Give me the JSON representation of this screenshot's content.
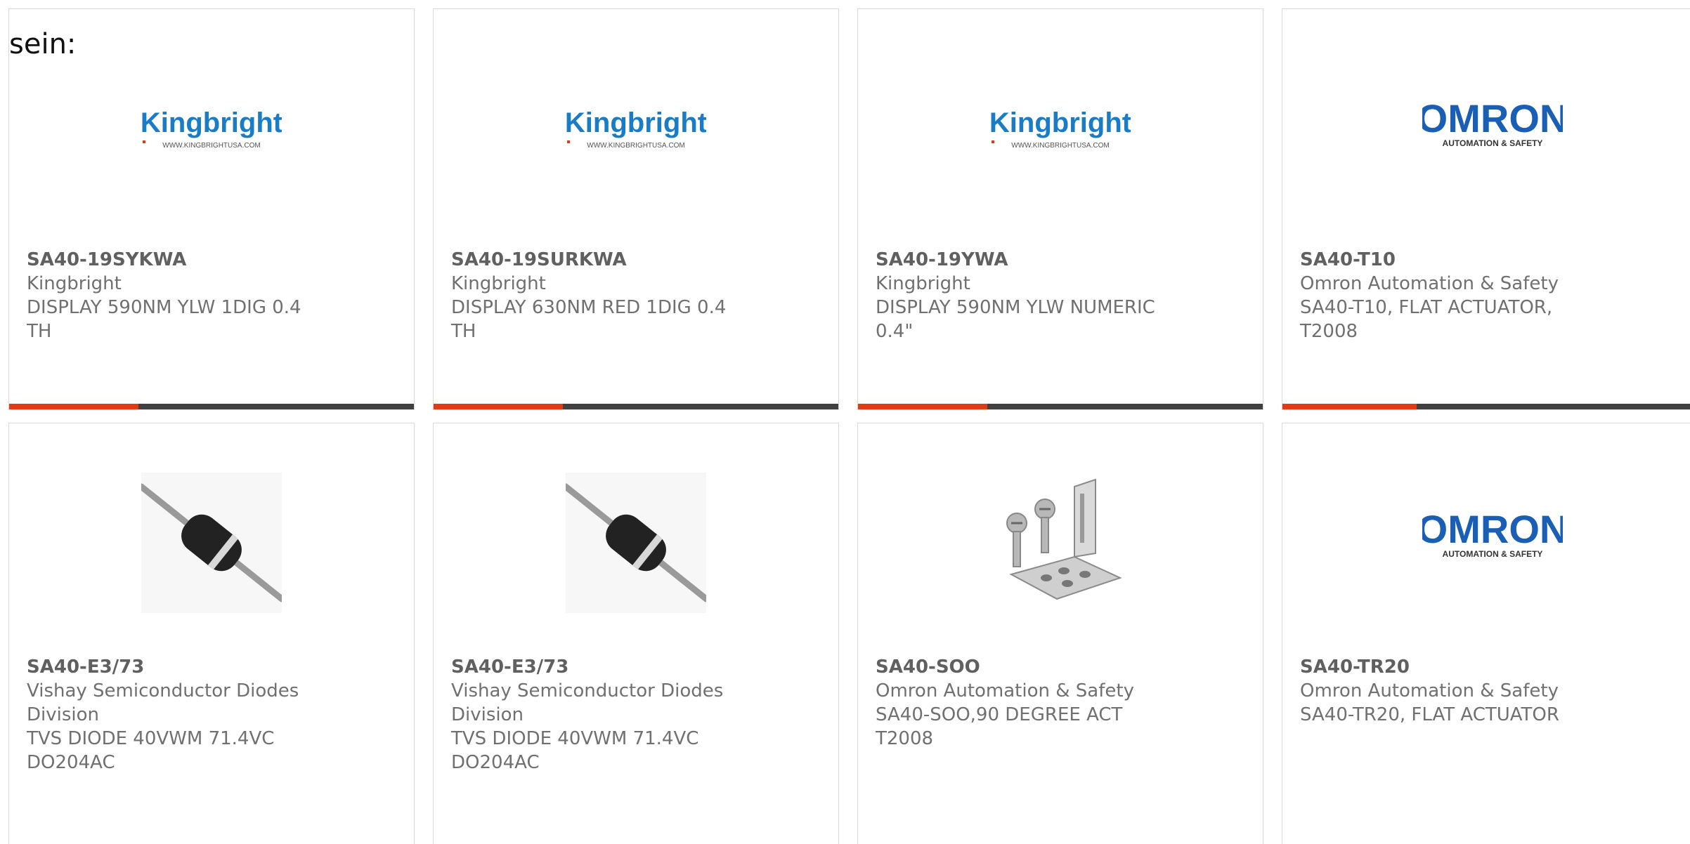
{
  "header": {
    "text": "sein:"
  },
  "products": [
    {
      "part_number": "SA40-19SYKWA",
      "manufacturer": "Kingbright",
      "desc_line1": "DISPLAY 590NM YLW 1DIG 0.4",
      "desc_line2": "TH",
      "image": "kingbright-logo",
      "logo_text": "Kingbright",
      "logo_url": "WWW.KINGBRIGHTUSA.COM"
    },
    {
      "part_number": "SA40-19SURKWA",
      "manufacturer": "Kingbright",
      "desc_line1": "DISPLAY 630NM RED 1DIG 0.4",
      "desc_line2": "TH",
      "image": "kingbright-logo",
      "logo_text": "Kingbright",
      "logo_url": "WWW.KINGBRIGHTUSA.COM"
    },
    {
      "part_number": "SA40-19YWA",
      "manufacturer": "Kingbright",
      "desc_line1": "DISPLAY 590NM YLW NUMERIC",
      "desc_line2": "0.4\"",
      "image": "kingbright-logo",
      "logo_text": "Kingbright",
      "logo_url": "WWW.KINGBRIGHTUSA.COM"
    },
    {
      "part_number": "SA40-T10",
      "manufacturer": "Omron Automation & Safety",
      "desc_line1": "SA40-T10, FLAT ACTUATOR,",
      "desc_line2": "T2008",
      "image": "omron-logo",
      "logo_text": "OMRON",
      "logo_sub": "AUTOMATION & SAFETY"
    },
    {
      "part_number": "SA40-E3/73",
      "manufacturer_line1": "Vishay Semiconductor Diodes",
      "manufacturer_line2": "Division",
      "desc_line1": "TVS DIODE 40VWM 71.4VC",
      "desc_line2": "DO204AC",
      "image": "diode-photo"
    },
    {
      "part_number": "SA40-E3/73",
      "manufacturer_line1": "Vishay Semiconductor Diodes",
      "manufacturer_line2": "Division",
      "desc_line1": "TVS DIODE 40VWM 71.4VC",
      "desc_line2": "DO204AC",
      "image": "diode-photo"
    },
    {
      "part_number": "SA40-SOO",
      "manufacturer": "Omron Automation & Safety",
      "desc_line1": "SA40-SOO,90 DEGREE ACT T2008",
      "image": "bracket-photo"
    },
    {
      "part_number": "SA40-TR20",
      "manufacturer": "Omron Automation & Safety",
      "desc_line1": "SA40-TR20, FLAT ACTUATOR",
      "image": "omron-logo",
      "logo_text": "OMRON",
      "logo_sub": "AUTOMATION & SAFETY"
    }
  ],
  "colors": {
    "accent_bar": "#e03c14",
    "bar_dark": "#404040",
    "text_gray": "#707070",
    "kingbright_blue": "#1a7cc4",
    "omron_blue": "#1a5fb4"
  }
}
